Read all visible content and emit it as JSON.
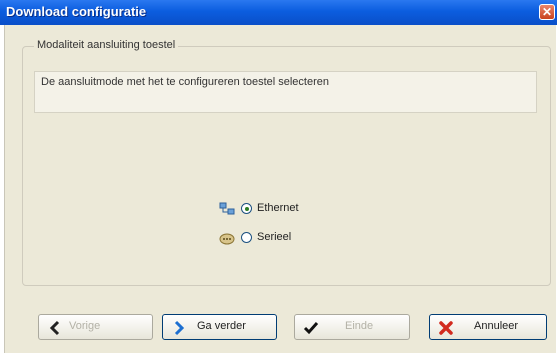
{
  "window": {
    "title": "Download configuratie",
    "close_icon": "close-icon"
  },
  "group": {
    "legend": "Modaliteit aansluiting toestel",
    "description": "De aansluitmode met het te configureren toestel selecteren"
  },
  "options": [
    {
      "icon": "network-icon",
      "label": "Ethernet",
      "selected": true
    },
    {
      "icon": "serial-icon",
      "label": "Serieel",
      "selected": false
    }
  ],
  "buttons": {
    "back": {
      "label": "Vorige",
      "icon": "arrow-left-icon",
      "enabled": false
    },
    "next": {
      "label": "Ga verder",
      "icon": "arrow-right-icon",
      "enabled": true
    },
    "finish": {
      "label": "Einde",
      "icon": "checkmark-icon",
      "enabled": false
    },
    "cancel": {
      "label": "Annuleer",
      "icon": "cancel-x-icon",
      "enabled": true
    }
  },
  "colors": {
    "titlebar": "#0b5ddf",
    "dialog_bg": "#ece9d8",
    "accent_blue": "#1d6fd1",
    "cancel_red": "#d22b1f"
  }
}
